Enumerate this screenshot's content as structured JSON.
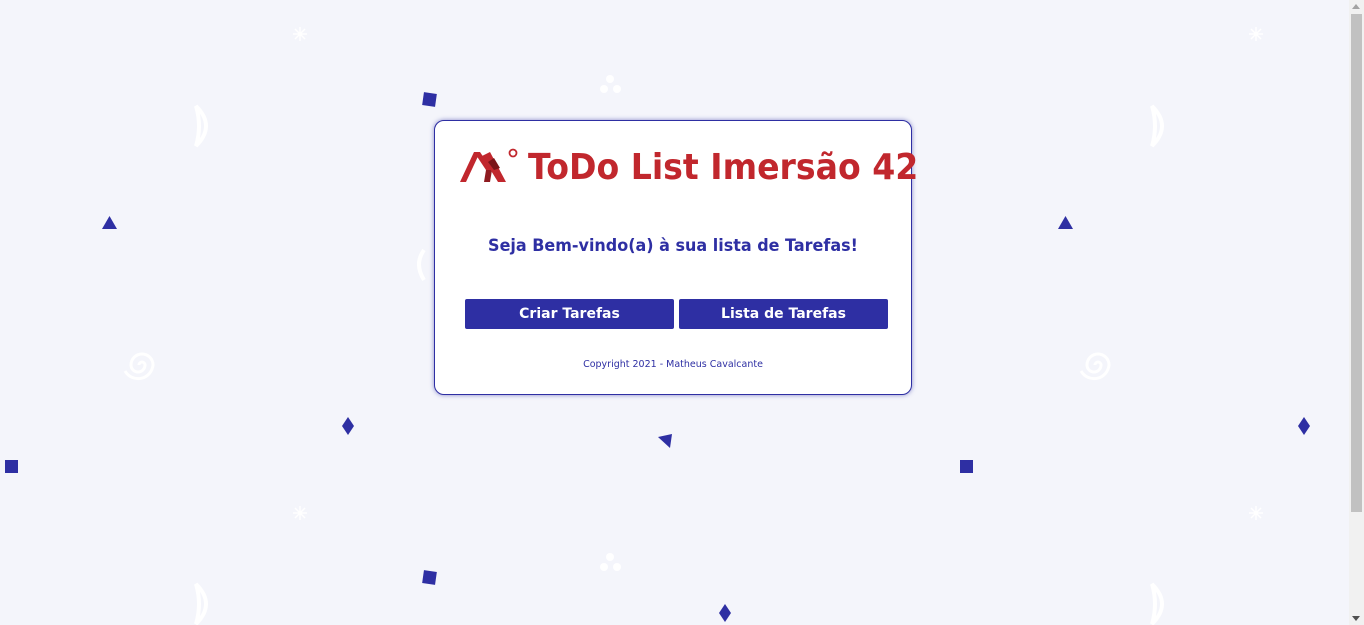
{
  "app": {
    "title": "ToDo List Imersão 42",
    "welcome": "Seja Bem-vindo(a) à sua lista de Tarefas!",
    "copyright": "Copyright 2021 - Matheus Cavalcante"
  },
  "actions": {
    "create_label": "Criar Tarefas",
    "list_label": "Lista de Tarefas"
  },
  "theme": {
    "background": "#f4f5fb",
    "primary": "#2e2fa3",
    "brand_red": "#c1272d",
    "card": "#ffffff"
  },
  "icons": {
    "logo": "mountain-logo-icon",
    "background_shapes": [
      "square",
      "triangle",
      "diamond",
      "crescent",
      "spiral",
      "dots",
      "sparkle"
    ]
  }
}
